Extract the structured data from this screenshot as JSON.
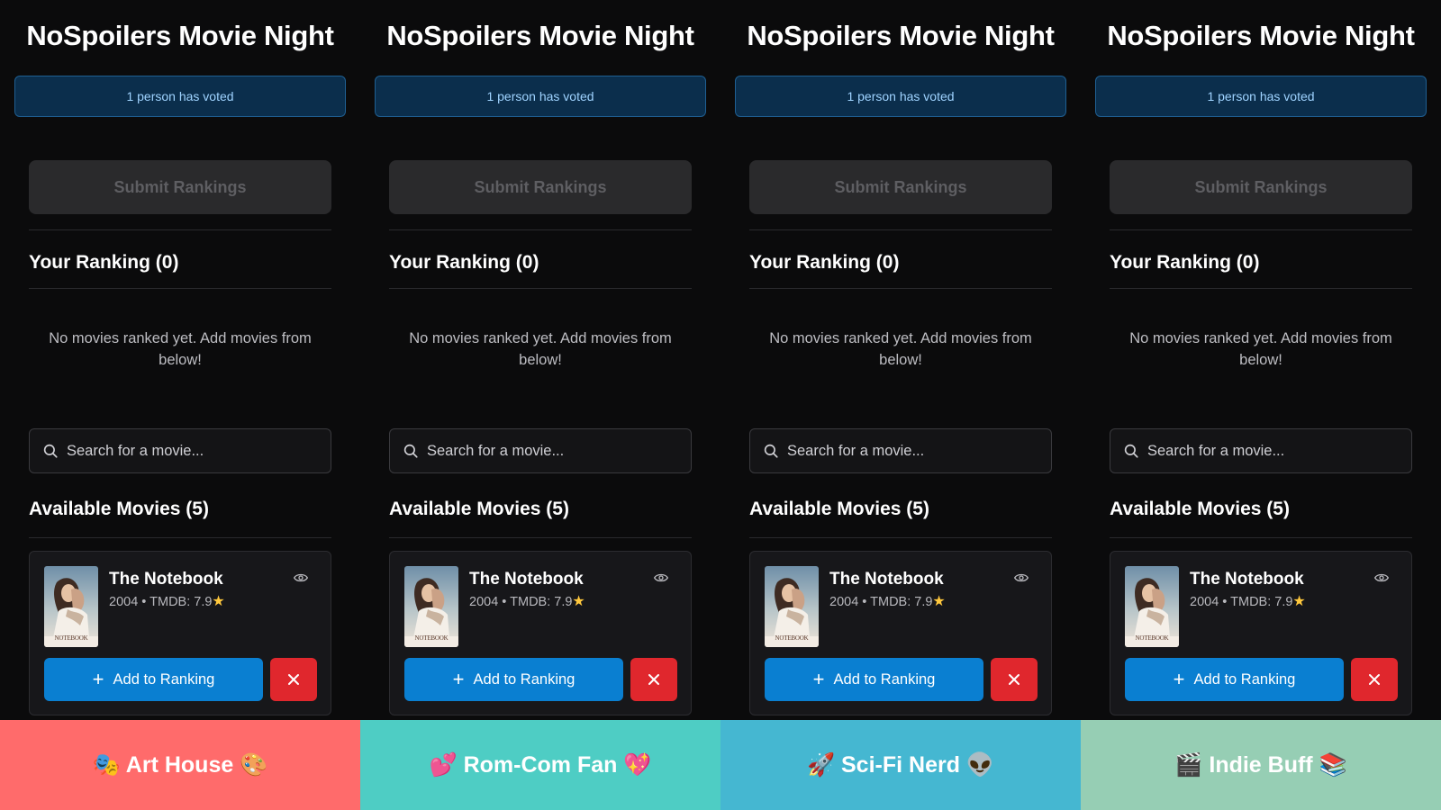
{
  "app_title": "NoSpoilers Movie Night",
  "vote_status": "1 person has voted",
  "submit_label": "Submit Rankings",
  "ranking_heading": "Your Ranking (0)",
  "empty_message": "No movies ranked yet. Add movies from below!",
  "search_placeholder": "Search for a movie...",
  "available_heading": "Available Movies (5)",
  "movie": {
    "title": "The Notebook",
    "meta": "2004 • TMDB: 7.9",
    "rating_icon": "star-icon",
    "poster_label": "NOTEBOOK",
    "watched_icon": "eye-icon"
  },
  "add_label": "Add to Ranking",
  "dismiss_icon": "close-icon",
  "personas": [
    {
      "label": "🎭 Art House 🎨",
      "color": "#ff6b6b"
    },
    {
      "label": "💕 Rom-Com Fan 💖",
      "color": "#4ecdc4"
    },
    {
      "label": "🚀 Sci-Fi Nerd 👽",
      "color": "#45b7d1"
    },
    {
      "label": "🎬 Indie Buff 📚",
      "color": "#96ceb4"
    }
  ],
  "colors": {
    "background": "#0b0b0c",
    "banner": "#0b2e4c",
    "primary": "#0a7fd1",
    "danger": "#e0272d",
    "disabled": "#2a2a2c"
  }
}
